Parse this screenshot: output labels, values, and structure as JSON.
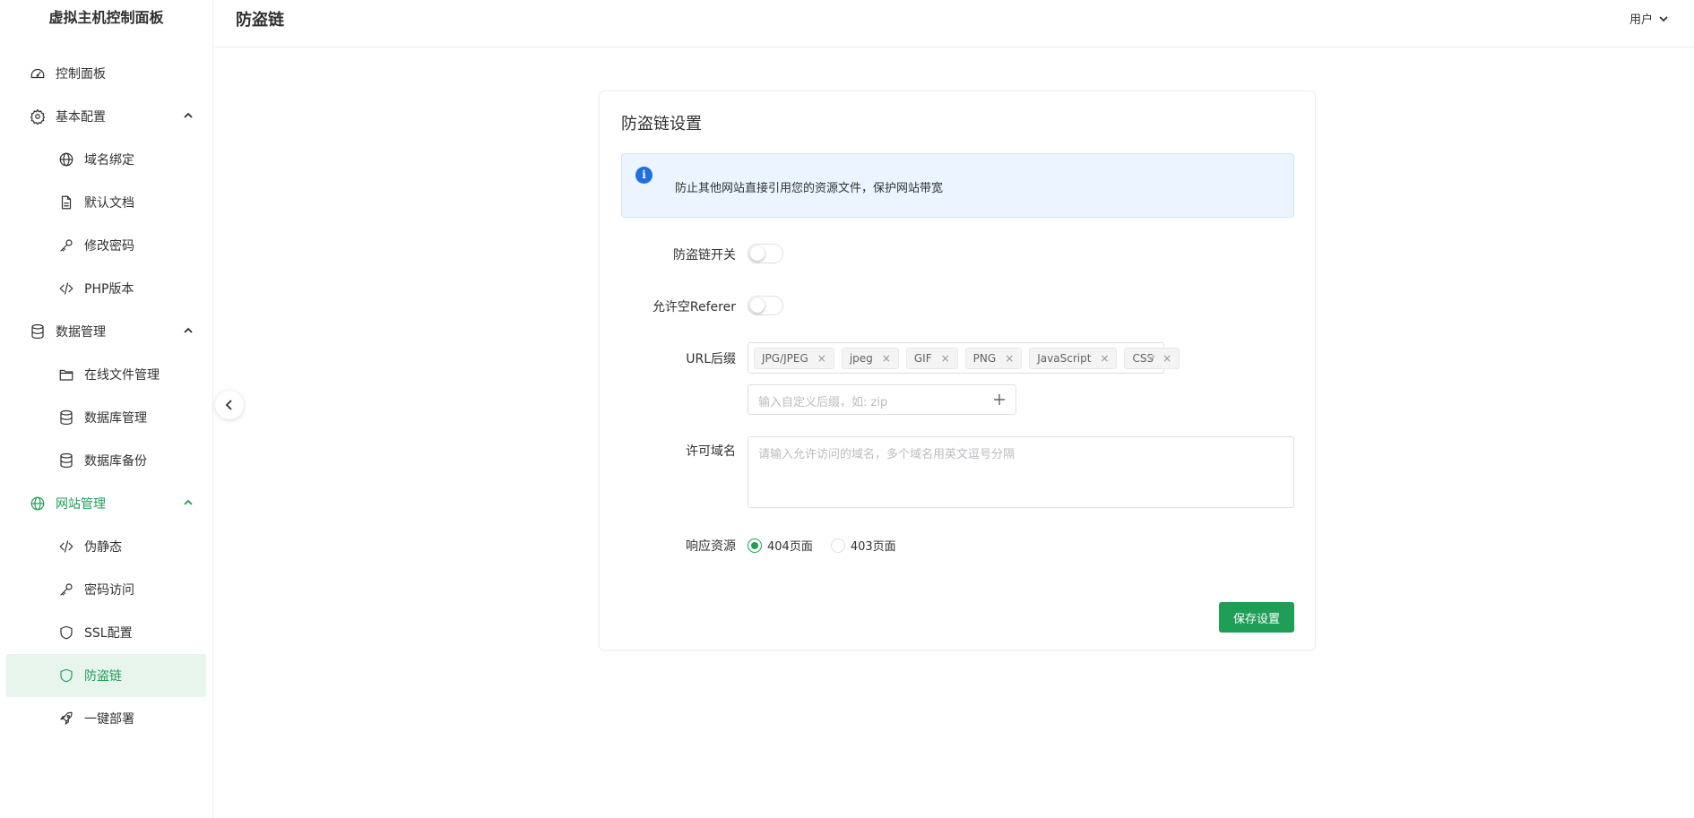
{
  "app": {
    "brand": "虚拟主机控制面板"
  },
  "header": {
    "title": "防盗链",
    "user": "用户"
  },
  "sidebar": {
    "items": [
      {
        "label": "控制面板",
        "icon": "dashboard-icon"
      },
      {
        "label": "基本配置",
        "icon": "gear-icon"
      },
      {
        "label": "域名绑定",
        "icon": "globe-icon"
      },
      {
        "label": "默认文档",
        "icon": "document-icon"
      },
      {
        "label": "修改密码",
        "icon": "key-icon"
      },
      {
        "label": "PHP版本",
        "icon": "code-icon"
      },
      {
        "label": "数据管理",
        "icon": "database-icon"
      },
      {
        "label": "在线文件管理",
        "icon": "folder-icon"
      },
      {
        "label": "数据库管理",
        "icon": "database-icon"
      },
      {
        "label": "数据库备份",
        "icon": "database-icon"
      },
      {
        "label": "网站管理",
        "icon": "globe-icon"
      },
      {
        "label": "伪静态",
        "icon": "code-icon"
      },
      {
        "label": "密码访问",
        "icon": "key-icon"
      },
      {
        "label": "SSL配置",
        "icon": "shield-icon"
      },
      {
        "label": "防盗链",
        "icon": "shield-icon"
      },
      {
        "label": "一键部署",
        "icon": "rocket-icon"
      }
    ]
  },
  "card": {
    "title": "防盗链设置",
    "alert": "防止其他网站直接引用您的资源文件，保护网站带宽",
    "switch_label": "防盗链开关",
    "switch_on": false,
    "empty_referer_label": "允许空Referer",
    "empty_referer_on": false,
    "suffix_label": "URL后缀",
    "suffix_tags": [
      "JPG/JPEG",
      "jpeg",
      "GIF",
      "PNG",
      "JavaScript",
      "CSS"
    ],
    "custom_suffix_placeholder": "输入自定义后缀，如: zip",
    "domain_label": "许可域名",
    "domain_placeholder": "请输入允许访问的域名，多个域名用英文逗号分隔",
    "response_label": "响应资源",
    "response_options": [
      "404页面",
      "403页面"
    ],
    "response_selected": "404页面",
    "save_label": "保存设置"
  },
  "colors": {
    "accent": "#1f9e56",
    "info": "#1e6fe0",
    "alert_bg": "#ecf5ff"
  }
}
